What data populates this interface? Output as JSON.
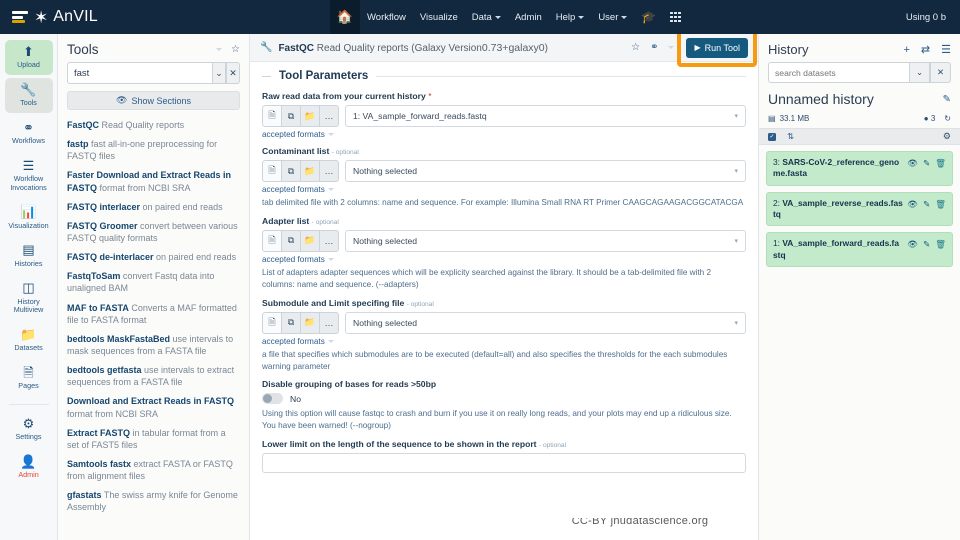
{
  "masthead": {
    "brand": "AnVIL",
    "home_icon": "home-icon",
    "nav_items": [
      {
        "label": "Workflow",
        "has_caret": false
      },
      {
        "label": "Visualize",
        "has_caret": false
      },
      {
        "label": "Data",
        "has_caret": true
      },
      {
        "label": "Admin",
        "has_caret": false
      },
      {
        "label": "Help",
        "has_caret": true
      },
      {
        "label": "User",
        "has_caret": true
      }
    ],
    "graduation_icon": "graduation-cap-icon",
    "apps_icon": "grid-apps-icon",
    "quota": "Using 0 b"
  },
  "activity_bar": {
    "items": [
      {
        "icon": "upload-icon",
        "glyph": "⬆",
        "label": "Upload",
        "state": "highlighted"
      },
      {
        "icon": "wrench-icon",
        "glyph": "🔧",
        "label": "Tools",
        "state": "active"
      },
      {
        "icon": "workflows-icon",
        "glyph": "⚭",
        "label": "Workflows",
        "state": "normal"
      },
      {
        "icon": "list-icon",
        "glyph": "☰",
        "label": "Workflow Invocations",
        "state": "normal"
      },
      {
        "icon": "chart-icon",
        "glyph": "📊",
        "label": "Visualization",
        "state": "normal"
      },
      {
        "icon": "histories-icon",
        "glyph": "▤",
        "label": "Histories",
        "state": "normal"
      },
      {
        "icon": "multiview-icon",
        "glyph": "◫",
        "label": "History Multiview",
        "state": "normal"
      },
      {
        "icon": "folder-icon",
        "glyph": "📁",
        "label": "Datasets",
        "state": "normal"
      },
      {
        "icon": "page-icon",
        "glyph": "📄",
        "label": "Pages",
        "state": "normal"
      }
    ],
    "bottom_items": [
      {
        "icon": "gear-icon",
        "glyph": "⚙",
        "label": "Settings",
        "state": "normal"
      },
      {
        "icon": "admin-user-icon",
        "glyph": "👤",
        "label": "Admin",
        "state": "danger"
      }
    ]
  },
  "tool_panel": {
    "title": "Tools",
    "caret_icon": "chevron-down-icon",
    "star_icon": "star-outline-icon",
    "search_value": "fast",
    "search_placeholder": "search tools",
    "search_advanced_icon": "double-chevron-icon",
    "search_clear_icon": "close-icon",
    "show_sections_label": "Show Sections",
    "show_sections_icon": "eye-icon",
    "tools": [
      {
        "name": "FastQC",
        "desc": "Read Quality reports"
      },
      {
        "name": "fastp",
        "desc": "fast all-in-one preprocessing for FASTQ files"
      },
      {
        "name": "Faster Download and Extract Reads in FASTQ",
        "desc": "format from NCBI SRA"
      },
      {
        "name": "FASTQ interlacer",
        "desc": "on paired end reads"
      },
      {
        "name": "FASTQ Groomer",
        "desc": "convert between various FASTQ quality formats"
      },
      {
        "name": "FASTQ de-interlacer",
        "desc": "on paired end reads"
      },
      {
        "name": "FastqToSam",
        "desc": "convert Fastq data into unaligned BAM"
      },
      {
        "name": "MAF to FASTA",
        "desc": "Converts a MAF formatted file to FASTA format"
      },
      {
        "name": "bedtools MaskFastaBed",
        "desc": "use intervals to mask sequences from a FASTA file"
      },
      {
        "name": "bedtools getfasta",
        "desc": "use intervals to extract sequences from a FASTA file"
      },
      {
        "name": "Download and Extract Reads in FASTQ",
        "desc": "format from NCBI SRA"
      },
      {
        "name": "Extract FASTQ",
        "desc": "in tabular format from a set of FAST5 files"
      },
      {
        "name": "Samtools fastx",
        "desc": "extract FASTA or FASTQ from alignment files"
      },
      {
        "name": "gfastats",
        "desc": "The swiss army knife for Genome Assembly"
      }
    ]
  },
  "tool_form": {
    "header": {
      "wrench_icon": "wrench-icon",
      "tool_name": "FastQC",
      "tool_desc": "Read Quality reports (Galaxy Version",
      "version": "0.73+galaxy0",
      "version_close": ")",
      "favorite_icon": "star-outline-icon",
      "share_icon": "share-icon",
      "options_icon": "chevron-down-icon",
      "run_label": "Run Tool",
      "run_icon": "play-icon",
      "highlight_color": "#f59a11"
    },
    "section_title": "Tool Parameters",
    "selector_icons": [
      {
        "icon": "single-dataset-icon",
        "glyph": "⬚"
      },
      {
        "icon": "multiple-datasets-icon",
        "glyph": "⧉"
      },
      {
        "icon": "dataset-collection-icon",
        "glyph": "🗀"
      },
      {
        "icon": "browse-datasets-icon",
        "glyph": "…"
      }
    ],
    "accepted_formats_label": "accepted formats",
    "fields": [
      {
        "label": "Raw read data from your current history",
        "required": true,
        "optional_label": "",
        "value": "1: VA_sample_forward_reads.fastq",
        "help": ""
      },
      {
        "label": "Contaminant list",
        "required": false,
        "optional_label": "optional",
        "value": "Nothing selected",
        "help": "tab delimited file with 2 columns: name and sequence. For example: Illumina Small RNA RT Primer CAAGCAGAAGACGGCATACGA"
      },
      {
        "label": "Adapter list",
        "required": false,
        "optional_label": "optional",
        "value": "Nothing selected",
        "help": "List of adapters adapter sequences which will be explicity searched against the library. It should be a tab-delimited file with 2 columns: name and sequence. (--adapters)"
      },
      {
        "label": "Submodule and Limit specifing file",
        "required": false,
        "optional_label": "optional",
        "value": "Nothing selected",
        "help": "a file that specifies which submodules are to be executed (default=all) and also specifies the thresholds for the each submodules warning parameter"
      }
    ],
    "toggle_field": {
      "label": "Disable grouping of bases for reads >50bp",
      "state": "No",
      "help": "Using this option will cause fastqc to crash and burn if you use it on really long reads, and your plots may end up a ridiculous size. You have been warned! (--nogroup)"
    },
    "last_field": {
      "label": "Lower limit on the length of the sequence to be shown in the report",
      "optional_label": "optional",
      "value": ""
    }
  },
  "history": {
    "title": "History",
    "add_icon": "plus-icon",
    "switch_icon": "switch-histories-icon",
    "menu_icon": "hamburger-menu-icon",
    "search_value": "",
    "search_placeholder": "search datasets",
    "search_advanced_icon": "double-chevron-icon",
    "search_clear_icon": "close-icon",
    "name": "Unnamed history",
    "edit_icon": "pencil-icon",
    "size": "33.1 MB",
    "size_icon": "database-icon",
    "shown_count": "3",
    "shown_icon": "tag-icon",
    "refresh_icon": "refresh-icon",
    "select_all_icon": "checkbox-checked-icon",
    "expand_icon": "expand-collapse-icon",
    "gear_icon": "gear-icon",
    "datasets": [
      {
        "index": "3:",
        "name": "SARS-CoV-2_reference_genome.fasta",
        "state": "ok"
      },
      {
        "index": "2:",
        "name": "VA_sample_reverse_reads.fastq",
        "state": "ok"
      },
      {
        "index": "1:",
        "name": "VA_sample_forward_reads.fastq",
        "state": "ok"
      }
    ],
    "item_actions": [
      {
        "icon": "eye-icon",
        "glyph": "👁"
      },
      {
        "icon": "pencil-icon",
        "glyph": "✎"
      },
      {
        "icon": "trash-icon",
        "glyph": "🗑"
      }
    ]
  },
  "watermark": {
    "text": "CC-BY jhudatascience.org"
  }
}
